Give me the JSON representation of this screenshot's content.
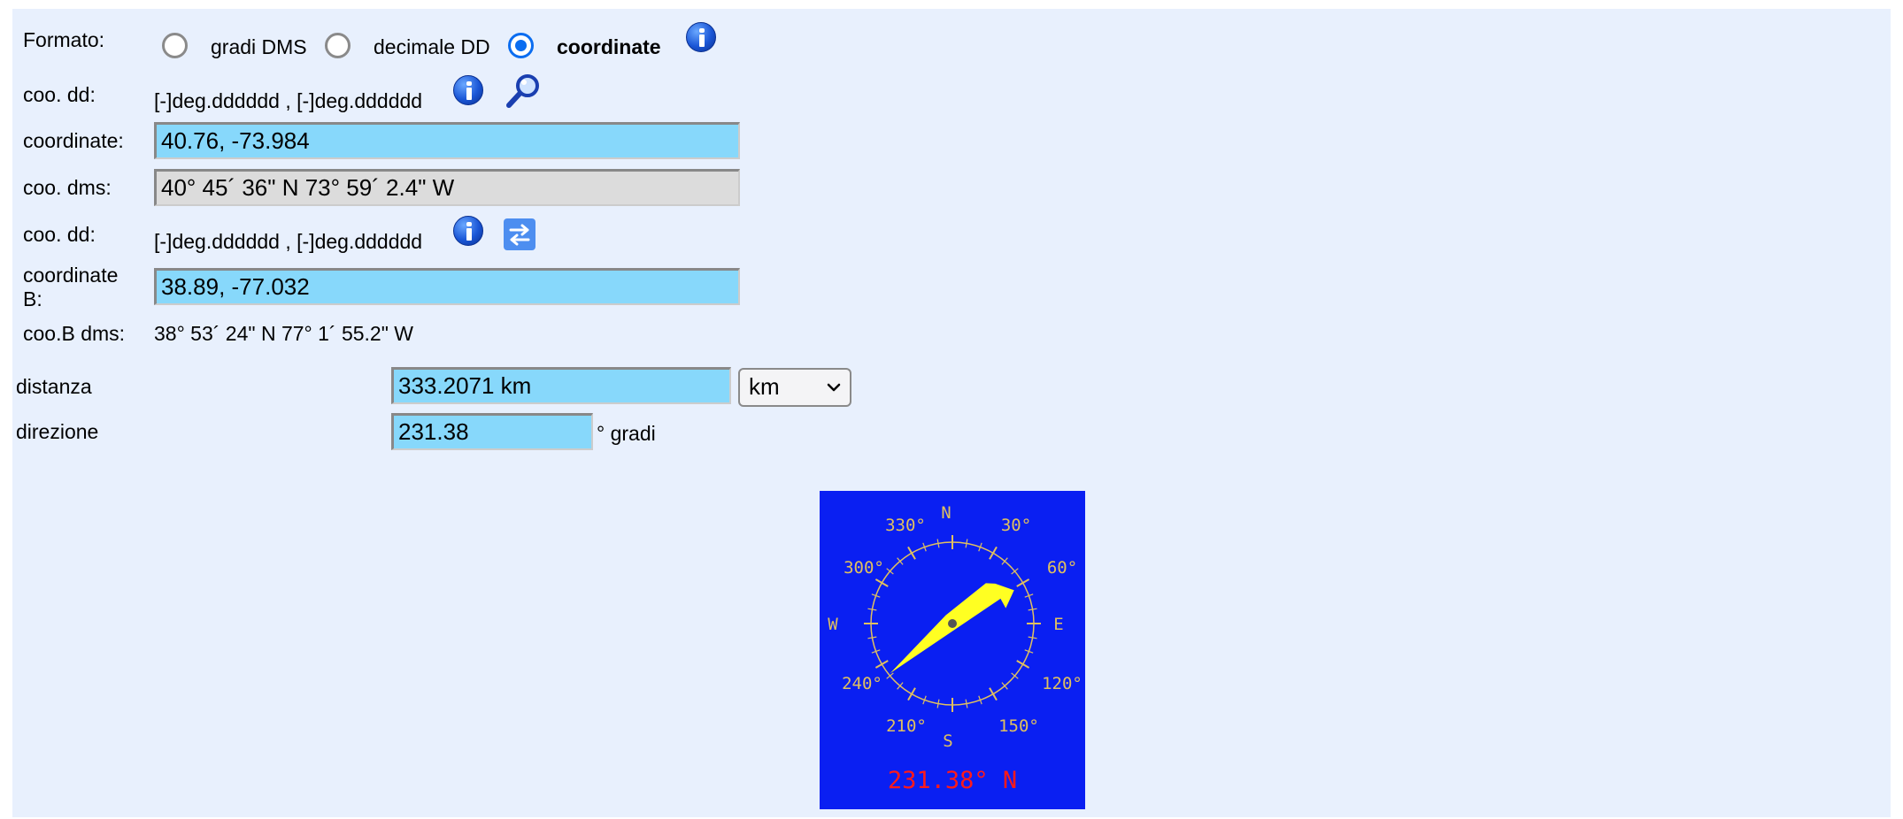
{
  "format": {
    "label": "Formato:",
    "options": [
      "gradi DMS",
      "decimale DD",
      "coordinate"
    ],
    "selected": "coordinate",
    "icons": [
      "info-icon"
    ]
  },
  "coord_a": {
    "hint_label": "coo. dd:",
    "hint": "[-]deg.dddddd , [-]deg.dddddd",
    "icons": [
      "info-icon",
      "magnifier-icon"
    ],
    "input_label": "coordinate:",
    "value": "40.76, -73.984",
    "dms_label": "coo. dms:",
    "dms_value": "40° 45´ 36\" N  73° 59´ 2.4\" W"
  },
  "coord_b": {
    "hint_label": "coo. dd:",
    "hint": "[-]deg.dddddd , [-]deg.dddddd",
    "icons": [
      "info-icon",
      "swap-icon"
    ],
    "input_label_line1": "coordinate",
    "input_label_line2": "B:",
    "value": "38.89, -77.032",
    "dms_label": "coo.B dms:",
    "dms_value": "38° 53´ 24\" N 77° 1´ 55.2\" W"
  },
  "distance": {
    "label": "distanza",
    "value": "333.2071 km",
    "unit_selected": "km"
  },
  "direction": {
    "label": "direzione",
    "value": "231.38",
    "unit": "° gradi"
  },
  "compass": {
    "bearing": 231.38,
    "readout": "231.38° N",
    "cardinals": {
      "n": "N",
      "e": "E",
      "s": "S",
      "w": "W"
    },
    "degree_labels": [
      "30°",
      "60°",
      "120°",
      "150°",
      "210°",
      "240°",
      "300°",
      "330°"
    ],
    "colors": {
      "background": "#0a1ff2",
      "needle": "#ffff22",
      "ticks": "#e0c060",
      "readout": "#ff1a1a"
    }
  },
  "colors": {
    "panel": "#e8f0fd",
    "input": "#87d8fb",
    "readonly_input": "#dcdcdc",
    "radio_selected": "#0b6df0"
  }
}
